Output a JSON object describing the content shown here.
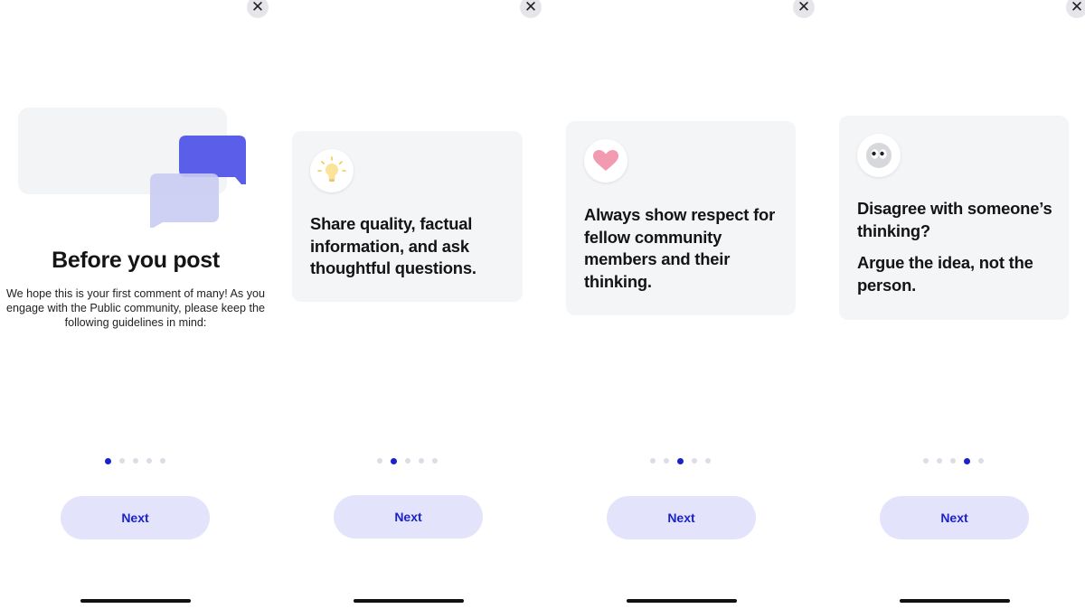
{
  "close_symbol": "✕",
  "screens": [
    {
      "title": "Before you post",
      "body": "We hope this is your first comment of many! As you engage with the Public community, please keep the following guidelines in mind:",
      "illustration": "chat-bubbles-icon",
      "active_dot": 1,
      "total_dots": 5,
      "next_label": "Next"
    },
    {
      "icon": "lightbulb-icon",
      "text": "Share quality, factual information, and ask thoughtful questions.",
      "active_dot": 2,
      "total_dots": 5,
      "next_label": "Next"
    },
    {
      "icon": "heart-icon",
      "text": "Always show respect for fellow community members and their thinking.",
      "active_dot": 3,
      "total_dots": 5,
      "next_label": "Next"
    },
    {
      "icon": "eyes-icon",
      "text": "Disagree with someone’s thinking?",
      "text2": "Argue the idea, not the person.",
      "active_dot": 4,
      "total_dots": 5,
      "next_label": "Next"
    }
  ],
  "colors": {
    "accent": "#1b22c9",
    "button_bg": "#e3e4fb",
    "card_bg": "#f4f5f7",
    "bubble_dark": "#5a5ee8",
    "bubble_light": "#c9cbf3"
  }
}
